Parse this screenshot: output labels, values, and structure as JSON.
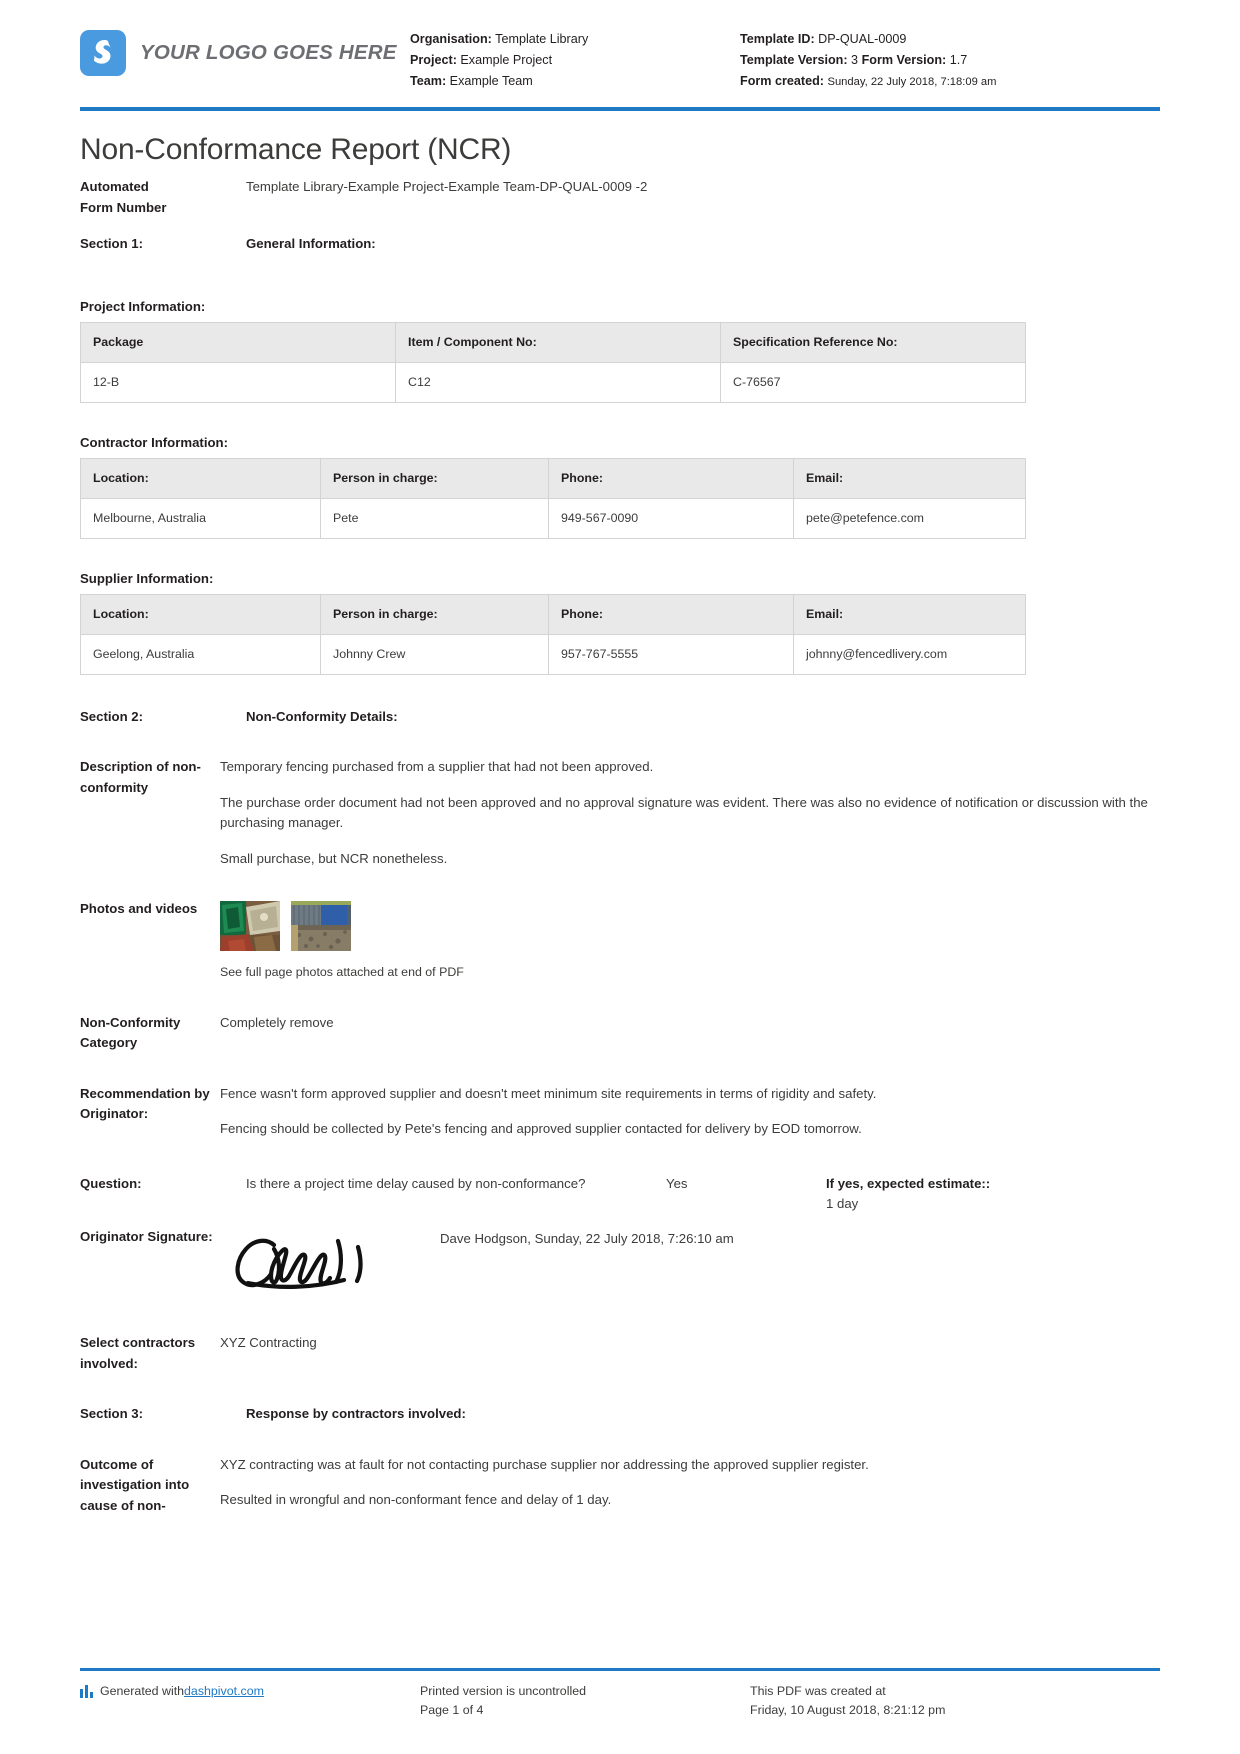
{
  "header": {
    "logo_text": "YOUR LOGO GOES HERE",
    "organisation_label": "Organisation:",
    "organisation_value": "Template Library",
    "project_label": "Project:",
    "project_value": "Example Project",
    "team_label": "Team:",
    "team_value": "Example Team",
    "template_id_label": "Template ID:",
    "template_id_value": "DP-QUAL-0009",
    "template_version_label": "Template Version:",
    "template_version_value": "3",
    "form_version_label": "Form Version:",
    "form_version_value": "1.7",
    "form_created_label": "Form created:",
    "form_created_value": "Sunday, 22 July 2018, 7:18:09 am"
  },
  "title": "Non-Conformance Report (NCR)",
  "automated_form": {
    "label_line1": "Automated",
    "label_line2": "Form Number",
    "value": "Template Library-Example Project-Example Team-DP-QUAL-0009   -2"
  },
  "section1": {
    "label": "Section 1:",
    "value": "General Information:"
  },
  "project_information": {
    "caption": "Project Information:",
    "headers": [
      "Package",
      "Item / Component No:",
      "Specification Reference No:"
    ],
    "rows": [
      [
        "12-B",
        "C12",
        "C-76567"
      ]
    ]
  },
  "contractor_information": {
    "caption": "Contractor Information:",
    "headers": [
      "Location:",
      "Person in charge:",
      "Phone:",
      "Email:"
    ],
    "rows": [
      [
        "Melbourne, Australia",
        "Pete",
        "949-567-0090",
        "pete@petefence.com"
      ]
    ]
  },
  "supplier_information": {
    "caption": "Supplier Information:",
    "headers": [
      "Location:",
      "Person in charge:",
      "Phone:",
      "Email:"
    ],
    "rows": [
      [
        "Geelong, Australia",
        "Johnny Crew",
        "957-767-5555",
        "johnny@fencedlivery.com"
      ]
    ]
  },
  "section2": {
    "label": "Section 2:",
    "value": "Non-Conformity Details:"
  },
  "description": {
    "label": "Description of non-conformity",
    "paragraphs": [
      "Temporary fencing purchased from a supplier that had not been approved.",
      "The purchase order document had not been approved and no approval signature was evident. There was also no evidence of notification or discussion with the purchasing manager.",
      "Small purchase, but NCR nonetheless."
    ]
  },
  "photos": {
    "label": "Photos and videos",
    "caption": "See full page photos attached at end of PDF",
    "count": 2
  },
  "category": {
    "label": "Non-Conformity Category",
    "value": "Completely remove"
  },
  "recommendation": {
    "label": "Recommendation by Originator:",
    "paragraphs": [
      "Fence wasn't form approved supplier and doesn't meet minimum site requirements in terms of rigidity and safety.",
      "Fencing should be collected by Pete's fencing and approved supplier contacted for delivery by EOD tomorrow."
    ]
  },
  "question": {
    "label": "Question:",
    "text": "Is there a project time delay caused by non-conformance?",
    "answer": "Yes",
    "estimate_label": "If yes, expected estimate::",
    "estimate_value": "1 day"
  },
  "signature": {
    "label": "Originator Signature:",
    "name_and_time": "Dave Hodgson, Sunday, 22 July 2018, 7:26:10 am"
  },
  "contractors": {
    "label": "Select contractors involved:",
    "value": "XYZ Contracting"
  },
  "section3": {
    "label": "Section 3:",
    "value": "Response by contractors involved:"
  },
  "outcome": {
    "label": "Outcome of investigation into cause of non-",
    "paragraphs": [
      "XYZ contracting was at fault for not contacting purchase supplier nor addressing the approved supplier register.",
      "Resulted in wrongful and non-conformant fence and delay of 1 day."
    ]
  },
  "footer": {
    "generated_prefix": "Generated with ",
    "generated_link": "dashpivot.com",
    "uncontrolled": "Printed version is uncontrolled",
    "page": "Page 1 of 4",
    "created_line1": "This PDF was created at",
    "created_line2": "Friday, 10 August 2018, 8:21:12 pm"
  },
  "colors": {
    "accent_blue": "#2079c4",
    "logo_blue": "#4a9ae0",
    "table_header": "#e9e9e9",
    "text": "#231f20"
  }
}
